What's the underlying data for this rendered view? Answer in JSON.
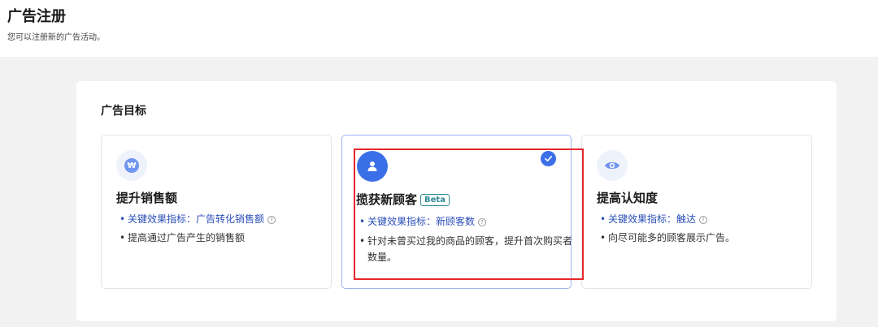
{
  "header": {
    "title": "广告注册",
    "subtitle": "您可以注册新的广告活动。"
  },
  "section": {
    "title": "广告目标"
  },
  "cards": [
    {
      "title": "提升销售额",
      "icon": "won-icon",
      "metric": "关键效果指标：广告转化销售额",
      "description": "提高通过广告产生的销售额"
    },
    {
      "title": "揽获新顾客",
      "badge": "Beta",
      "icon": "user-icon",
      "selected": true,
      "metric": "关键效果指标：新顾客数",
      "description": "针对未曾买过我的商品的顾客，提升首次购买者数量。"
    },
    {
      "title": "提高认知度",
      "icon": "eye-icon",
      "metric": "关键效果指标：触达",
      "description": "向尽可能多的顾客展示广告。"
    }
  ],
  "icons": {
    "help": "?",
    "won": "₩",
    "bullet": "•"
  },
  "colors": {
    "accent": "#3b6fe8",
    "highlight": "#e8262a",
    "link": "#2b4fb8",
    "beta": "#2e8a92"
  }
}
